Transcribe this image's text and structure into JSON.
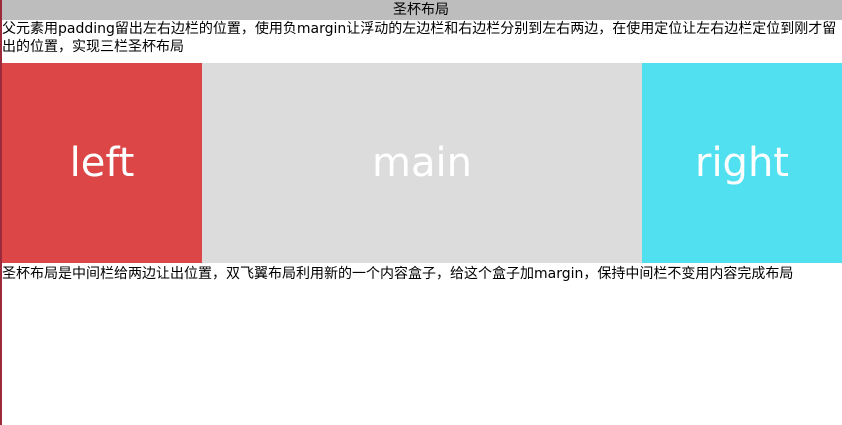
{
  "header": {
    "title": "圣杯布局"
  },
  "description": "父元素用padding留出左右边栏的位置，使用负margin让浮动的左边栏和右边栏分别到左右两边，在使用定位让左右边栏定位到刚才留出的位置，实现三栏圣杯布局",
  "columns": {
    "left": {
      "label": "left",
      "color": "#dc4646"
    },
    "main": {
      "label": "main",
      "color": "#dcdcdc"
    },
    "right": {
      "label": "right",
      "color": "#50e0f0"
    }
  },
  "footer": {
    "text": "圣杯布局是中间栏给两边让出位置，双飞翼布局利用新的一个内容盒子，给这个盒子加margin，保持中间栏不变用内容完成布局"
  },
  "accents": {
    "edge": "#9b2a3a",
    "header_bg": "#bdbdbd"
  }
}
